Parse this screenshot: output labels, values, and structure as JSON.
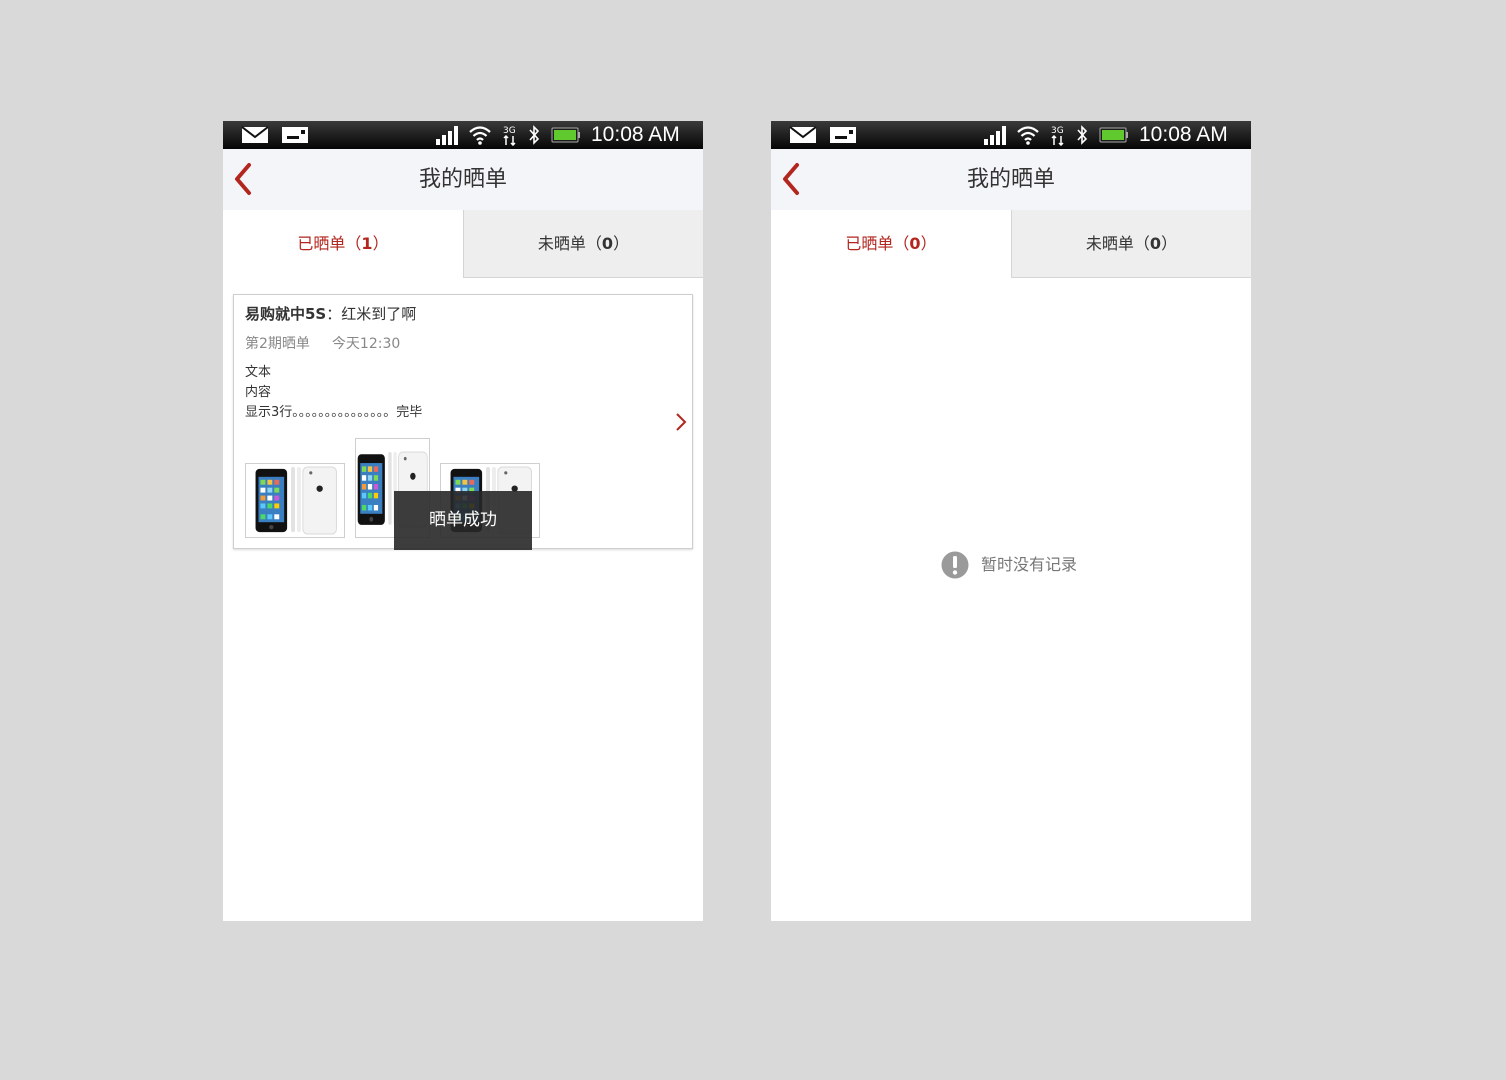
{
  "screens": [
    {
      "status_bar": {
        "time": "10:08 AM"
      },
      "header": {
        "title": "我的晒单"
      },
      "tabs": [
        {
          "label": "已晒单（",
          "count": "1",
          "suffix": "）",
          "active": true
        },
        {
          "label": "未晒单（",
          "count": "0",
          "suffix": "）",
          "active": false
        }
      ],
      "card": {
        "user": "易购就中5S",
        "separator": "：",
        "comment": "红米到了啊",
        "period": "第2期晒单",
        "time": "今天12:30",
        "text_lines": [
          "文本",
          "内容",
          "显示3行。。。。。。。。。。。。。。。完毕"
        ]
      },
      "toast": "晒单成功"
    },
    {
      "status_bar": {
        "time": "10:08 AM"
      },
      "header": {
        "title": "我的晒单"
      },
      "tabs": [
        {
          "label": "已晒单（",
          "count": "0",
          "suffix": "）",
          "active": true
        },
        {
          "label": "未晒单（",
          "count": "0",
          "suffix": "）",
          "active": false
        }
      ],
      "empty_state": {
        "text": "暂时没有记录"
      }
    }
  ],
  "colors": {
    "accent": "#b2261e",
    "background": "#d9d9d9",
    "header_bg": "#f4f5f9",
    "inactive_tab_bg": "#eeeeee"
  }
}
